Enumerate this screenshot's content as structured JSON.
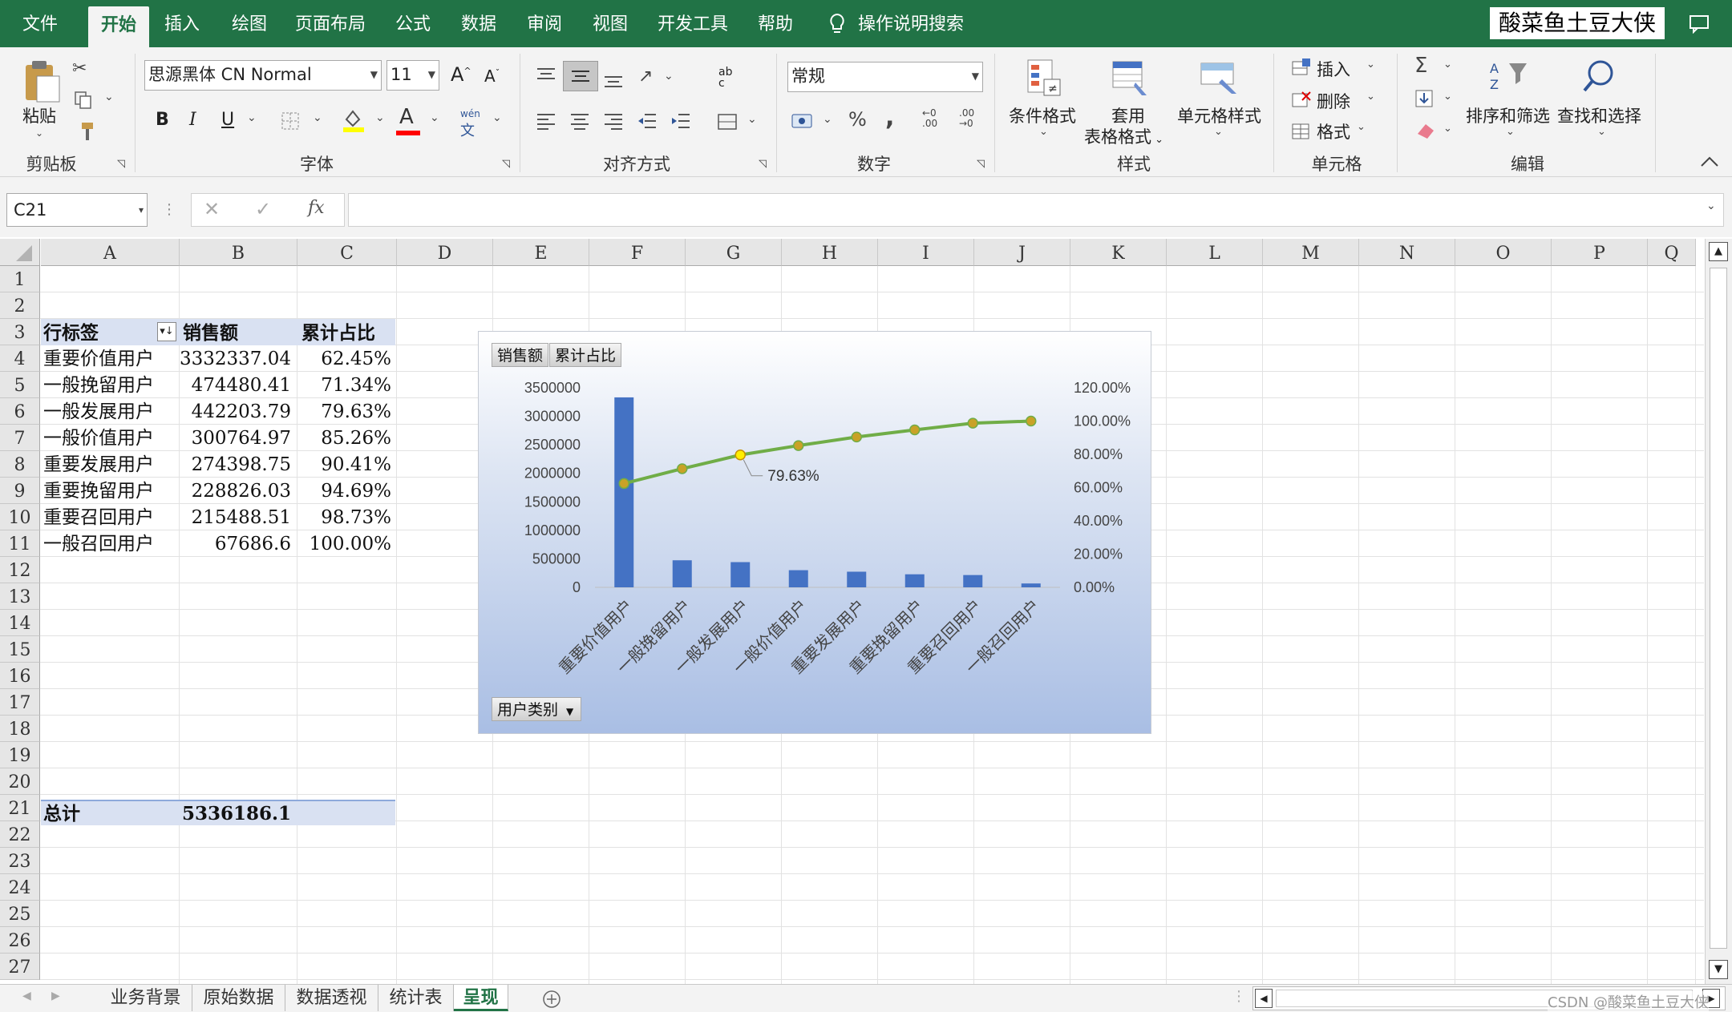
{
  "ribbon_tabs": [
    {
      "label": "文件"
    },
    {
      "label": "开始"
    },
    {
      "label": "插入"
    },
    {
      "label": "绘图"
    },
    {
      "label": "页面布局"
    },
    {
      "label": "公式"
    },
    {
      "label": "数据"
    },
    {
      "label": "审阅"
    },
    {
      "label": "视图"
    },
    {
      "label": "开发工具"
    },
    {
      "label": "帮助"
    }
  ],
  "active_tab": "开始",
  "tell_me": "操作说明搜索",
  "account_name": "酸菜鱼土豆大侠",
  "clipboard": {
    "paste": "粘贴",
    "group": "剪贴板"
  },
  "font": {
    "name": "思源黑体 CN Normal",
    "size": "11",
    "group": "字体",
    "bold": "B",
    "italic": "I",
    "underline": "U",
    "grow": "A",
    "shrink": "A",
    "color_letter": "A",
    "pinyin_top": "wén",
    "pinyin_bottom": "文"
  },
  "alignment": {
    "group": "对齐方式",
    "wrap_top": "ab",
    "wrap_bottom": "c"
  },
  "number": {
    "format": "常规",
    "group": "数字",
    "percent": "%",
    "comma": ",",
    "inc_decimal_top": "←0",
    "inc_decimal_bottom": ".00",
    "dec_decimal_top": ".00",
    "dec_decimal_bottom": "→0"
  },
  "styles": {
    "conditional": "条件格式",
    "table_format_1": "套用",
    "table_format_2": "表格格式",
    "cell_styles": "单元格样式",
    "group": "样式"
  },
  "cells": {
    "insert": "插入",
    "delete": "删除",
    "format": "格式",
    "group": "单元格"
  },
  "editing": {
    "sigma": "Σ",
    "sort_filter": "排序和筛选",
    "find_select": "查找和选择",
    "group": "编辑"
  },
  "formula_bar": {
    "name_box": "C21",
    "fx": "fx",
    "cancel": "✕",
    "enter": "✓",
    "formula": ""
  },
  "columns": [
    "A",
    "B",
    "C",
    "D",
    "E",
    "F",
    "G",
    "H",
    "I",
    "J",
    "K",
    "L",
    "M",
    "N",
    "O",
    "P",
    "Q"
  ],
  "rows": [
    "1",
    "2",
    "3",
    "4",
    "5",
    "6",
    "7",
    "8",
    "9",
    "10",
    "11",
    "12",
    "13",
    "14",
    "15",
    "16",
    "17",
    "18",
    "19",
    "20",
    "21",
    "22",
    "23",
    "24",
    "25",
    "26",
    "27"
  ],
  "pivot": {
    "header": [
      "行标签",
      "销售额",
      "累计占比"
    ],
    "rows": [
      [
        "重要价值用户",
        "3332337.04",
        "62.45%"
      ],
      [
        "一般挽留用户",
        "474480.41",
        "71.34%"
      ],
      [
        "一般发展用户",
        "442203.79",
        "79.63%"
      ],
      [
        "一般价值用户",
        "300764.97",
        "85.26%"
      ],
      [
        "重要发展用户",
        "274398.75",
        "90.41%"
      ],
      [
        "重要挽留用户",
        "228826.03",
        "94.69%"
      ],
      [
        "重要召回用户",
        "215488.51",
        "98.73%"
      ],
      [
        "一般召回用户",
        "67686.6",
        "100.00%"
      ]
    ],
    "total": [
      "总计",
      "5336186.1"
    ]
  },
  "chart_field_buttons": {
    "series_1": "销售额",
    "series_2": "累计占比",
    "axis_field": "用户类别"
  },
  "chart_data": {
    "type": "bar",
    "categories": [
      "重要价值用户",
      "一般挽留用户",
      "一般发展用户",
      "一般价值用户",
      "重要发展用户",
      "重要挽留用户",
      "重要召回用户",
      "一般召回用户"
    ],
    "series": [
      {
        "name": "销售额",
        "type": "bar",
        "axis": "left",
        "values": [
          3332337.04,
          474480.41,
          442203.79,
          300764.97,
          274398.75,
          228826.03,
          215488.51,
          67686.6
        ],
        "color": "#4472c4"
      },
      {
        "name": "累计占比",
        "type": "line",
        "axis": "right",
        "values": [
          62.45,
          71.34,
          79.63,
          85.26,
          90.41,
          94.69,
          98.73,
          100.0
        ],
        "color": "#70ad47",
        "marker_color": "#c9a227"
      }
    ],
    "y_left": {
      "min": 0,
      "max": 3500000,
      "ticks": [
        "0",
        "500000",
        "1000000",
        "1500000",
        "2000000",
        "2500000",
        "3000000",
        "3500000"
      ]
    },
    "y_right": {
      "min": 0,
      "max": 120,
      "ticks": [
        "0.00%",
        "20.00%",
        "40.00%",
        "60.00%",
        "80.00%",
        "100.00%",
        "120.00%"
      ]
    },
    "data_label": {
      "index": 2,
      "text": "79.63%"
    },
    "grid": false,
    "legend": "none"
  },
  "sheet_tabs": [
    {
      "label": "业务背景"
    },
    {
      "label": "原始数据"
    },
    {
      "label": "数据透视"
    },
    {
      "label": "统计表"
    },
    {
      "label": "呈现"
    }
  ],
  "active_sheet": "呈现",
  "watermark": "CSDN @酸菜鱼土豆大侠"
}
